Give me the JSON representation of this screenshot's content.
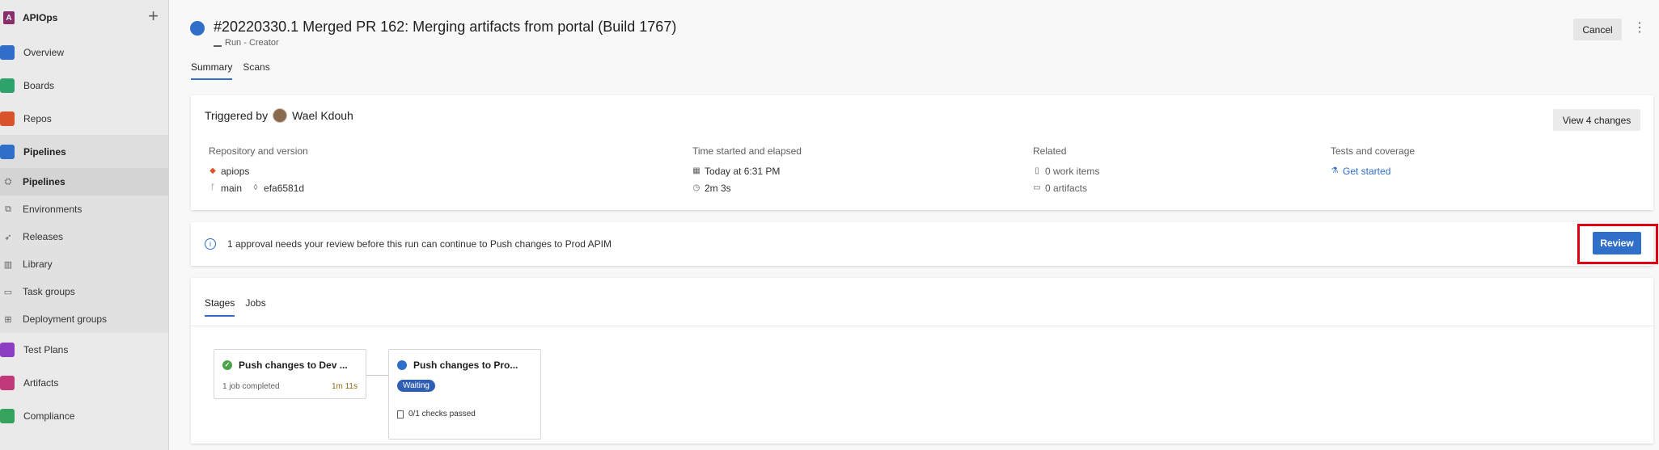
{
  "org": {
    "badge": "A",
    "name": "APIOps"
  },
  "nav": {
    "items": [
      {
        "label": "Overview",
        "color": "#2f6ec9"
      },
      {
        "label": "Boards",
        "color": "#2ea26b"
      },
      {
        "label": "Repos",
        "color": "#d9532c"
      },
      {
        "label": "Pipelines",
        "color": "#2f6ec9"
      }
    ],
    "pipelines_sub": [
      "Pipelines",
      "Environments",
      "Releases",
      "Library",
      "Task groups",
      "Deployment groups"
    ],
    "bottom": [
      {
        "label": "Test Plans",
        "color": "#8a3fc2"
      },
      {
        "label": "Artifacts",
        "color": "#c2397a"
      },
      {
        "label": "Compliance",
        "color": "#36a35c"
      }
    ]
  },
  "header": {
    "title": "#20220330.1 Merged PR 162: Merging artifacts from portal (Build 1767)",
    "subtitle": "Run - Creator",
    "cancel": "Cancel",
    "more": "⋮",
    "tabs": [
      "Summary",
      "Scans"
    ]
  },
  "summary": {
    "triggered_by": "Triggered by",
    "user": "Wael Kdouh",
    "view_changes": "View 4 changes",
    "repo_head": "Repository and version",
    "repo": "apiops",
    "branch": "main",
    "commit": "efa6581d",
    "time_head": "Time started and elapsed",
    "started": "Today at 6:31 PM",
    "elapsed": "2m 3s",
    "related_head": "Related",
    "work_items": "0 work items",
    "artifacts": "0 artifacts",
    "tests_head": "Tests and coverage",
    "get_started": "Get started"
  },
  "approval": {
    "text": "1 approval needs your review before this run can continue to Push changes to Prod APIM",
    "review": "Review"
  },
  "stages": {
    "tabs": [
      "Stages",
      "Jobs"
    ],
    "stage1": {
      "title": "Push changes to Dev ...",
      "meta": "1 job completed",
      "duration": "1m 11s"
    },
    "stage2": {
      "title": "Push changes to Pro...",
      "status": "Waiting",
      "checks": "0/1 checks passed"
    }
  }
}
